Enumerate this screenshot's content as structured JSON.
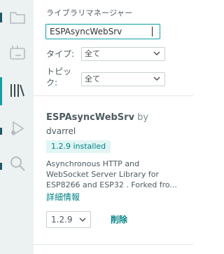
{
  "panel": {
    "title": "ライブラリマネージャー"
  },
  "search": {
    "value": "ESPAsyncWebSrv"
  },
  "filters": {
    "type_label": "タイプ:",
    "type_value": "全て",
    "topic_label_line1": "トピッ",
    "topic_label_line2": "ク:",
    "topic_value": "全て"
  },
  "library": {
    "name": "ESPAsyncWebSrv",
    "by": "by",
    "author": "dvarrel",
    "installed_badge": "1.2.9 installed",
    "description": "Asynchronous HTTP and WebSocket Server Library for ESP8266 and ESP32 . Forked fro...",
    "more_info": "詳細情報",
    "selected_version": "1.2.9",
    "remove_label": "削除"
  },
  "colors": {
    "accent": "#008184",
    "active_indicator": "#0ca1a6",
    "activity_bar_bg": "#ecf1f1",
    "badge_bg": "#e1f5f5"
  },
  "icons": {
    "activity_bar": [
      "folder-icon",
      "board-icon",
      "library-icon",
      "debug-icon",
      "search-icon"
    ],
    "select": "chevron-down-icon"
  }
}
